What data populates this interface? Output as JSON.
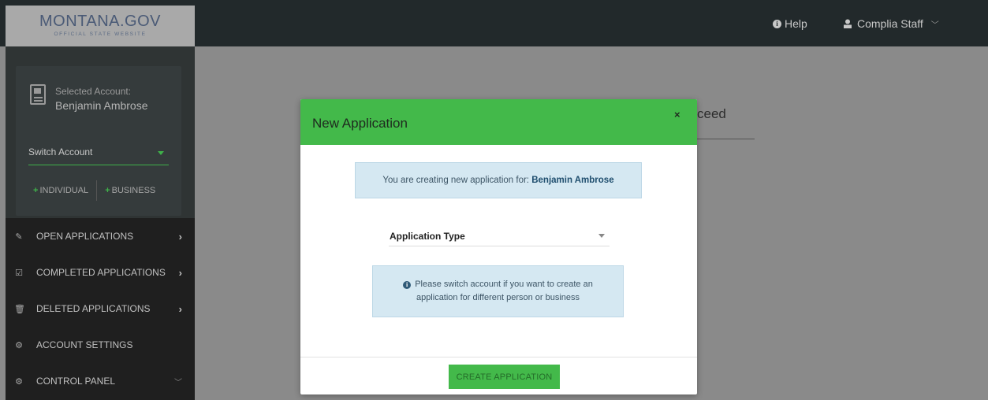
{
  "header": {
    "logo_main": "MONTANA.GOV",
    "logo_sub": "OFFICIAL STATE WEBSITE",
    "help_label": "Help",
    "user_label": "Complia Staff"
  },
  "sidebar": {
    "account": {
      "label": "Selected Account:",
      "name": "Benjamin Ambrose",
      "switch_label": "Switch Account",
      "individual_label": "INDIVIDUAL",
      "business_label": "BUSINESS"
    },
    "items": [
      {
        "label": "OPEN APPLICATIONS",
        "icon": "edit-icon"
      },
      {
        "label": "COMPLETED APPLICATIONS",
        "icon": "check-square-icon"
      },
      {
        "label": "DELETED APPLICATIONS",
        "icon": "trash-icon"
      },
      {
        "label": "ACCOUNT SETTINGS",
        "icon": "gear-icon"
      },
      {
        "label": "CONTROL PANEL",
        "icon": "cogs-icon"
      }
    ]
  },
  "background": {
    "partial_text": "ceed"
  },
  "modal": {
    "title": "New Application",
    "close_symbol": "×",
    "notice_prefix": "You are creating new application for:",
    "notice_name": "Benjamin Ambrose",
    "application_type_label": "Application Type",
    "info_line1": "Please switch account if you want to create an",
    "info_line2": "application for different person or business",
    "create_button": "CREATE APPLICATION"
  },
  "colors": {
    "accent_green": "#43b94a",
    "topbar": "#22292b",
    "info_bg": "#d5e8f2"
  }
}
